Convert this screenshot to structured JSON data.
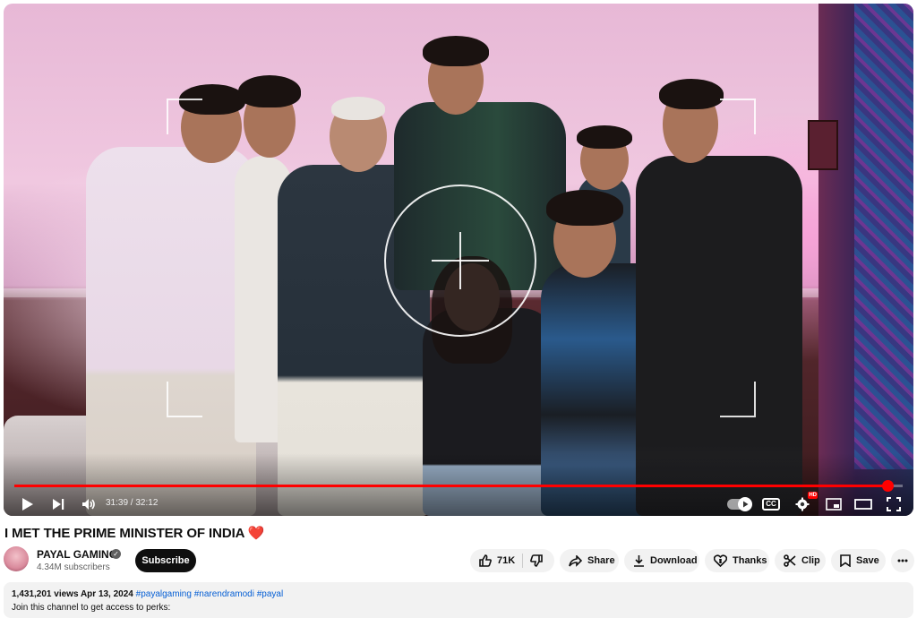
{
  "player": {
    "progress_fraction": 0.983,
    "time_current": "31:39",
    "time_total": "32:12",
    "time_separator": " / "
  },
  "video": {
    "title": "I MET THE PRIME MINISTER OF INDIA ❤️"
  },
  "channel": {
    "name": "PAYAL GAMING",
    "subscribers": "4.34M subscribers",
    "subscribe_label": "Subscribe"
  },
  "actions": {
    "like_count": "71K",
    "share_label": "Share",
    "download_label": "Download",
    "thanks_label": "Thanks",
    "clip_label": "Clip",
    "save_label": "Save"
  },
  "description": {
    "views": "1,431,201 views",
    "date": "Apr 13, 2024",
    "hashtags": "#payalgaming #narendramodi #payal",
    "text": "Join this channel to get access to perks:"
  },
  "icons": [
    "play-icon",
    "next-icon",
    "volume-icon",
    "autoplay-toggle",
    "cc-icon",
    "settings-icon",
    "miniplayer-icon",
    "theater-icon",
    "fullscreen-icon",
    "like-icon",
    "dislike-icon",
    "share-icon",
    "download-icon",
    "thanks-icon",
    "clip-icon",
    "save-icon",
    "more-icon",
    "verified-icon"
  ],
  "colors": {
    "progress": "#ff0000",
    "subscribe_bg": "#0f0f0f",
    "hashtag": "#065fd4",
    "pill_bg": "#f2f2f2"
  }
}
